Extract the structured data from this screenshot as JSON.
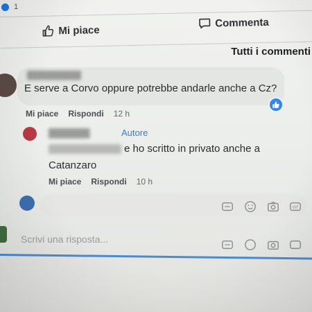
{
  "top": {
    "reaction_count": "1"
  },
  "actions": {
    "like_label": "Mi piace",
    "comment_label": "Commenta"
  },
  "sort_label": "Tutti i commenti",
  "comment": {
    "text": "E serve a Corvo oppure potrebbe andarle anche a Cz?",
    "like": "Mi piace",
    "reply": "Rispondi",
    "time": "12 h"
  },
  "reply": {
    "author_tag": "Autore",
    "text": "e ho scritto in privato anche a Catanzaro",
    "like": "Mi piace",
    "reply": "Rispondi",
    "time": "10 h"
  },
  "composer": {
    "placeholder": "Scrivi una risposta..."
  },
  "colors": {
    "accent": "#1877f2",
    "author_tag": "#3a7bd5"
  }
}
